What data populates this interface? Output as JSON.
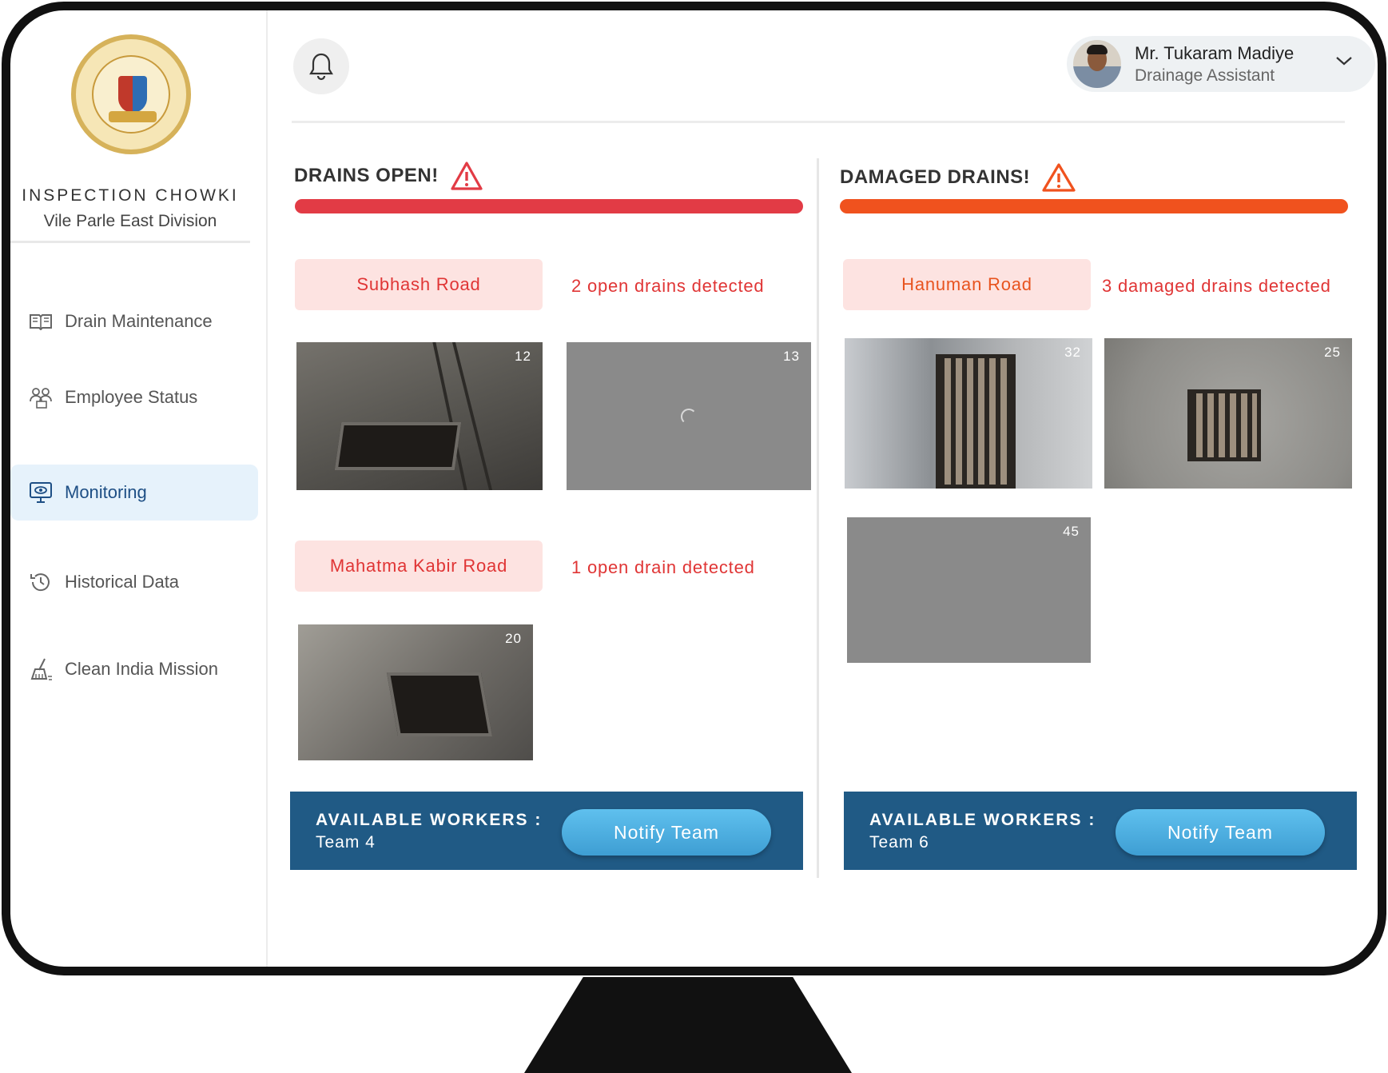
{
  "sidebar": {
    "org_title": "INSPECTION CHOWKI",
    "org_subtitle": "Vile Parle East Division",
    "items": [
      {
        "label": "Drain Maintenance",
        "icon": "book-icon"
      },
      {
        "label": "Employee Status",
        "icon": "people-icon"
      },
      {
        "label": "Monitoring",
        "icon": "monitor-eye-icon",
        "active": true
      },
      {
        "label": "Historical Data",
        "icon": "history-icon"
      },
      {
        "label": "Clean India Mission",
        "icon": "broom-icon"
      }
    ]
  },
  "header": {
    "user_name": "Mr. Tukaram Madiye",
    "user_role": "Drainage Assistant"
  },
  "open_drains": {
    "title": "DRAINS OPEN!",
    "accent": "#e23b45",
    "groups": [
      {
        "road": "Subhash Road",
        "status": "2 open drains detected",
        "photos": [
          "12",
          "13"
        ]
      },
      {
        "road": "Mahatma Kabir Road",
        "status": "1 open drain detected",
        "photos": [
          "20"
        ]
      }
    ],
    "workers_label": "AVAILABLE WORKERS :",
    "workers_team": "Team 4",
    "notify_label": "Notify Team"
  },
  "damaged_drains": {
    "title": "DAMAGED DRAINS!",
    "accent": "#f0521e",
    "groups": [
      {
        "road": "Hanuman Road",
        "status": "3 damaged drains detected",
        "photos": [
          "32",
          "25",
          "45"
        ]
      }
    ],
    "workers_label": "AVAILABLE WORKERS :",
    "workers_team": "Team 6",
    "notify_label": "Notify Team"
  },
  "colors": {
    "nav_active_bg": "#e6f2fb",
    "panel_blue": "#205a85",
    "button_blue": "#4aa9dc",
    "pill_bg": "#fde3e1"
  }
}
